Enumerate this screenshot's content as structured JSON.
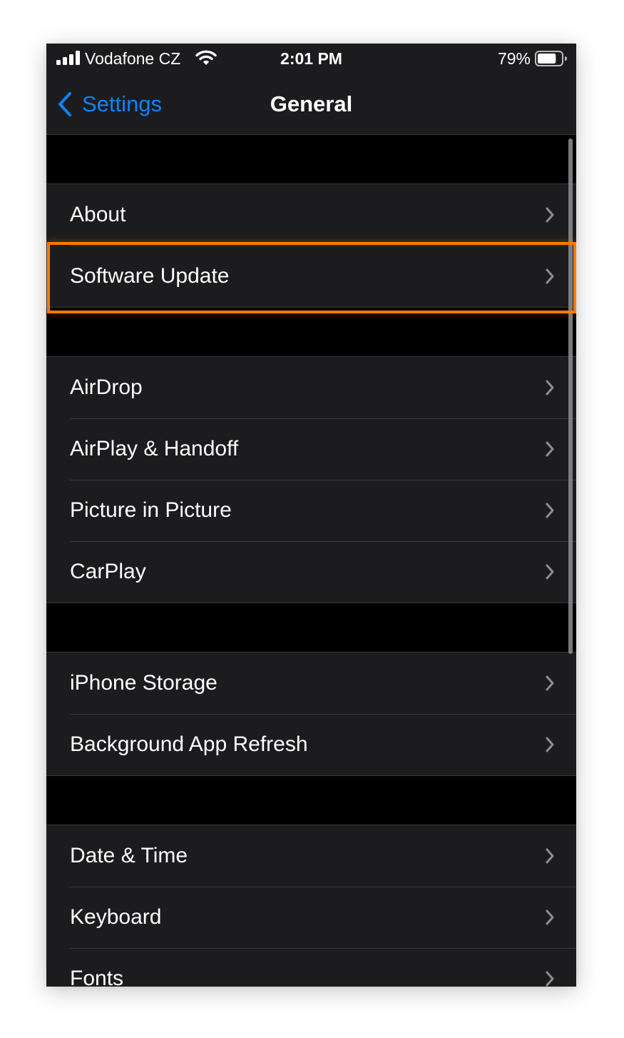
{
  "status_bar": {
    "carrier": "Vodafone CZ",
    "time": "2:01 PM",
    "battery_percent": "79%",
    "battery_level": 0.79
  },
  "nav": {
    "back_label": "Settings",
    "title": "General"
  },
  "groups": [
    {
      "items": [
        {
          "label": "About"
        },
        {
          "label": "Software Update",
          "highlighted": true
        }
      ]
    },
    {
      "items": [
        {
          "label": "AirDrop"
        },
        {
          "label": "AirPlay & Handoff"
        },
        {
          "label": "Picture in Picture"
        },
        {
          "label": "CarPlay"
        }
      ]
    },
    {
      "items": [
        {
          "label": "iPhone Storage"
        },
        {
          "label": "Background App Refresh"
        }
      ]
    },
    {
      "items": [
        {
          "label": "Date & Time"
        },
        {
          "label": "Keyboard"
        },
        {
          "label": "Fonts"
        }
      ]
    }
  ],
  "colors": {
    "accent": "#0a84ff",
    "highlight": "#ff7a00",
    "cell_background": "#1c1c1e",
    "background": "#000000"
  },
  "icons": [
    "signal-icon",
    "wifi-icon",
    "battery-icon",
    "back-chevron-icon",
    "chevron-right-icon"
  ]
}
